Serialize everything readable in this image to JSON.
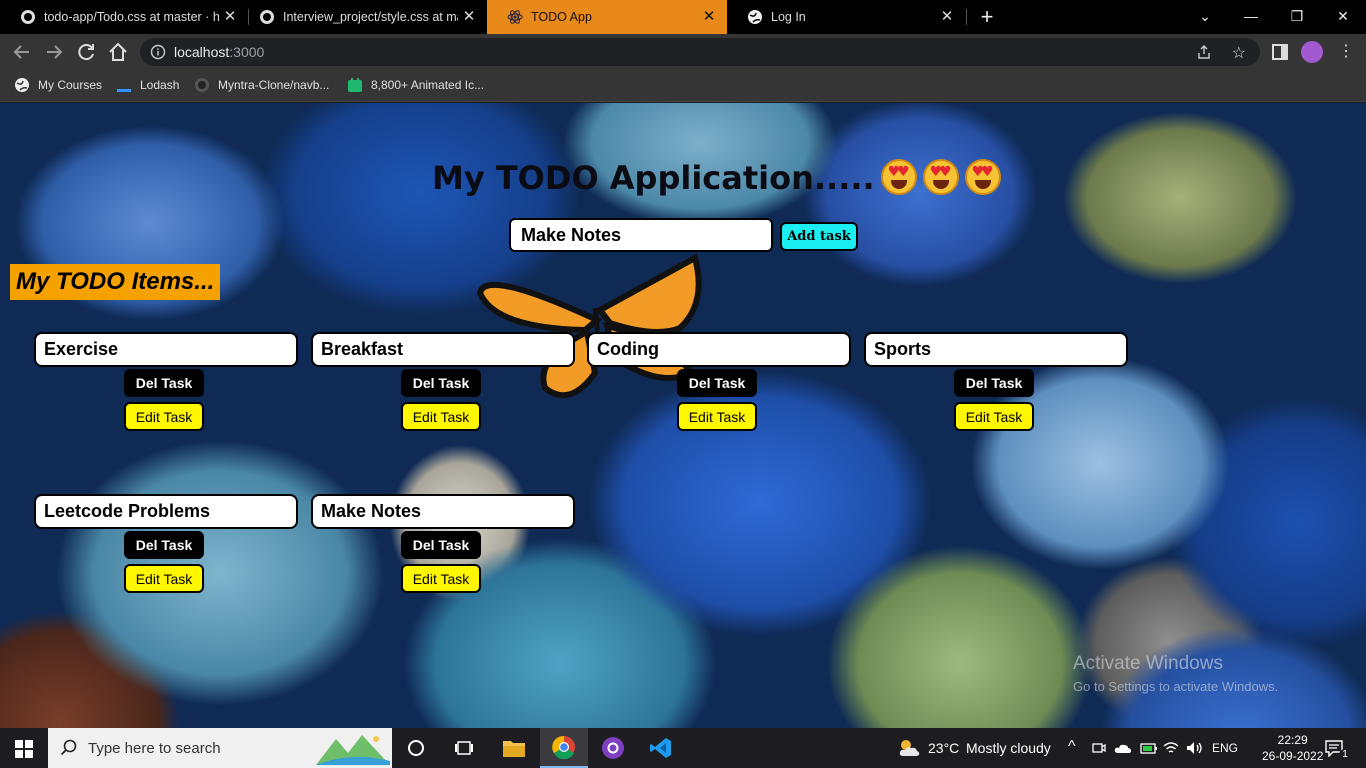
{
  "browser": {
    "tabs": [
      {
        "label": "todo-app/Todo.css at master · he",
        "active": false
      },
      {
        "label": "Interview_project/style.css at mas",
        "active": false
      },
      {
        "label": "TODO App",
        "active": true
      },
      {
        "label": "Log In",
        "active": false
      }
    ],
    "url_host": "localhost",
    "url_port": ":3000",
    "bookmarks": [
      {
        "label": "My Courses"
      },
      {
        "label": "Lodash"
      },
      {
        "label": "Myntra-Clone/navb..."
      },
      {
        "label": "8,800+ Animated Ic..."
      }
    ]
  },
  "app": {
    "heading": "My TODO Application.....",
    "input_value": "Make Notes",
    "add_button": "Add task",
    "items_title": "My TODO Items...",
    "del_label": "Del Task",
    "edit_label": "Edit Task",
    "tasks": [
      {
        "name": "Exercise"
      },
      {
        "name": "Breakfast"
      },
      {
        "name": "Coding"
      },
      {
        "name": "Sports"
      },
      {
        "name": "Leetcode Problems"
      },
      {
        "name": "Make Notes"
      }
    ]
  },
  "watermark": {
    "title": "Activate Windows",
    "subtitle": "Go to Settings to activate Windows."
  },
  "taskbar": {
    "search_placeholder": "Type here to search",
    "weather_temp": "23°C",
    "weather_text": "Mostly cloudy",
    "language": "ENG",
    "time": "22:29",
    "date": "26-09-2022",
    "notification_count": "1"
  },
  "colors": {
    "active_tab": "#e8891a",
    "add_button": "#1aeef0",
    "items_title_bg": "#f5a200",
    "edit_button": "#fff700",
    "del_button": "#000000"
  }
}
